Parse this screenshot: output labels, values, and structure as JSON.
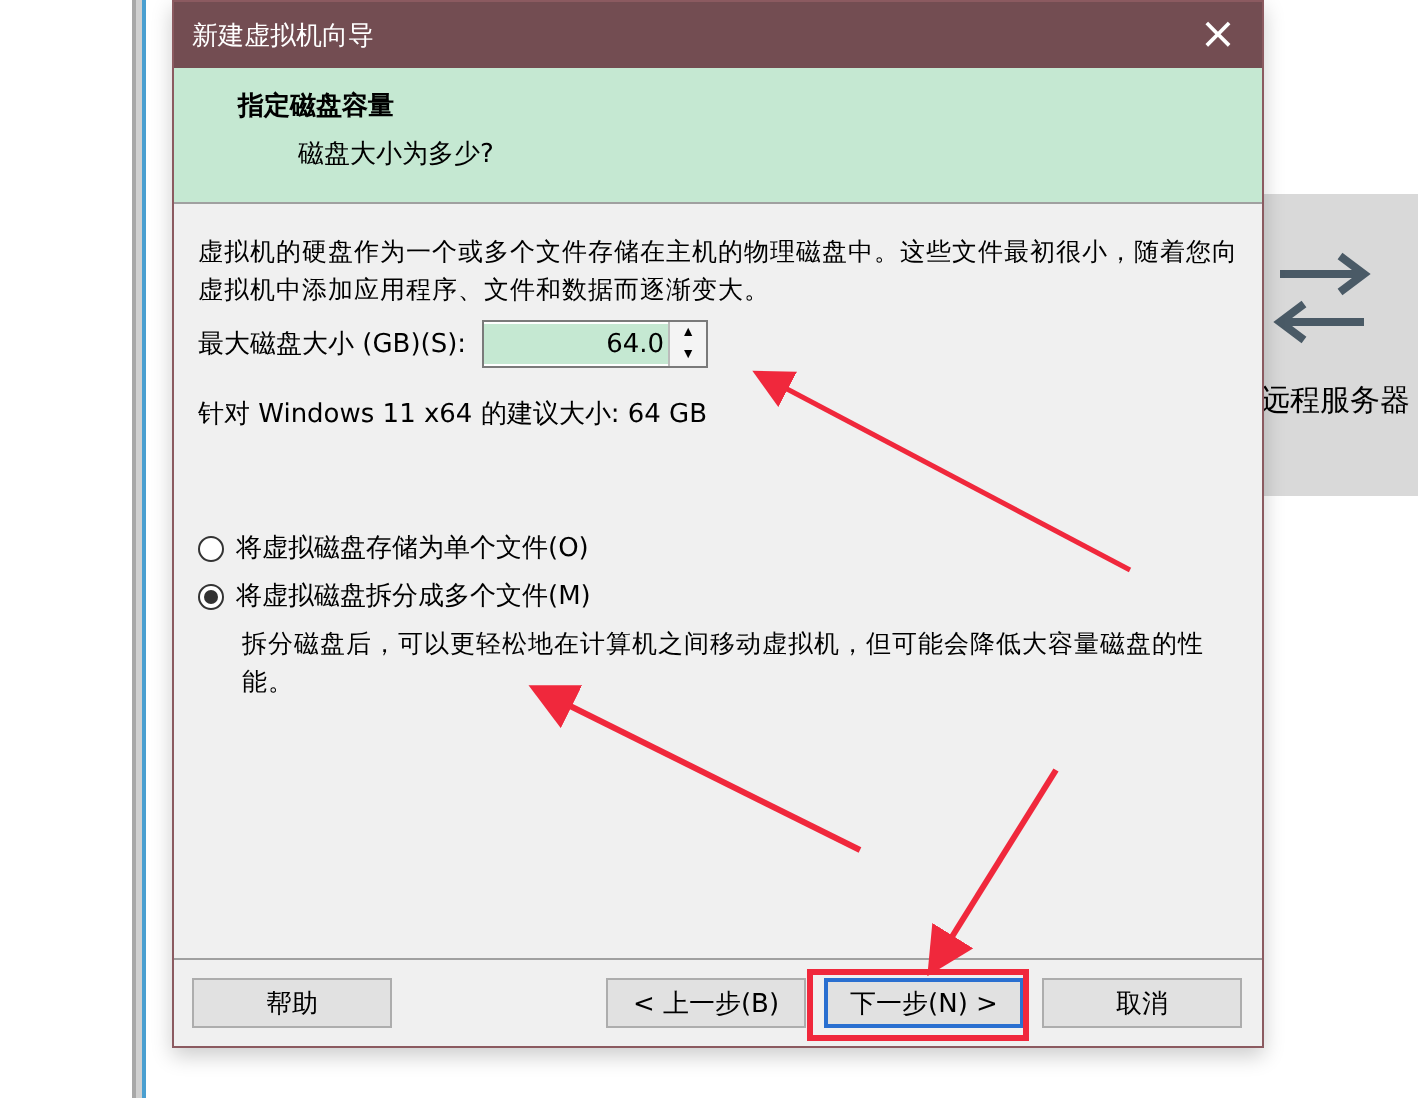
{
  "background": {
    "tile_label": "远程服务器"
  },
  "dialog": {
    "title": "新建虚拟机向导",
    "close": "×",
    "header": {
      "title": "指定磁盘容量",
      "subtitle": "磁盘大小为多少?"
    },
    "description": "虚拟机的硬盘作为一个或多个文件存储在主机的物理磁盘中。这些文件最初很小，随着您向虚拟机中添加应用程序、文件和数据而逐渐变大。",
    "size_field": {
      "label": "最大磁盘大小 (GB)(S):",
      "value": "64.0",
      "up": "▲",
      "down": "▼"
    },
    "recommendation": "针对 Windows 11 x64 的建议大小: 64 GB",
    "options": [
      {
        "label": "将虚拟磁盘存储为单个文件(O)",
        "selected": false
      },
      {
        "label": "将虚拟磁盘拆分成多个文件(M)",
        "selected": true
      }
    ],
    "split_note": "拆分磁盘后，可以更轻松地在计算机之间移动虚拟机，但可能会降低大容量磁盘的性能。",
    "buttons": [
      {
        "label": "帮助",
        "kind": "left"
      },
      {
        "label": "< 上一步(B)",
        "kind": "right"
      },
      {
        "label": "下一步(N) >",
        "kind": "default"
      },
      {
        "label": "取消",
        "kind": "right"
      }
    ]
  }
}
